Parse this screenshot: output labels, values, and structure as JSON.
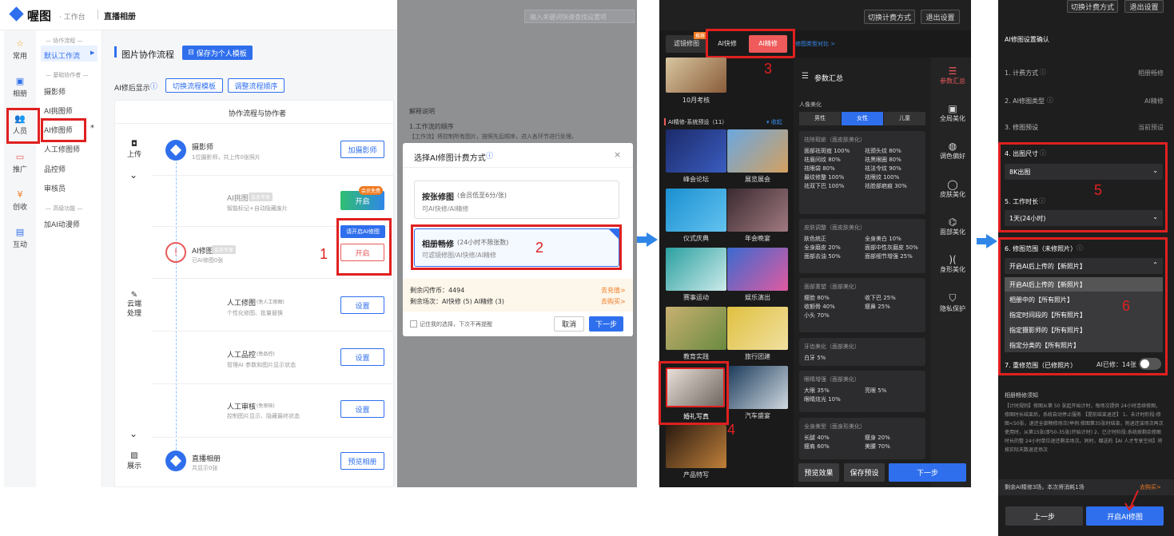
{
  "panel1": {
    "logo": "喔图",
    "workspace": "· 工作台",
    "breadcrumb": "直播相册",
    "nav": [
      {
        "label": "常用",
        "icon": "star-icon"
      },
      {
        "label": "相册",
        "icon": "album-icon"
      },
      {
        "label": "人员",
        "icon": "people-icon"
      },
      {
        "label": "推广",
        "icon": "promote-icon"
      },
      {
        "label": "创收",
        "icon": "revenue-icon"
      },
      {
        "label": "互动",
        "icon": "interact-icon"
      }
    ],
    "sub_groups": {
      "flow": "— 协作流程 —",
      "basic": "— 基础协作者 —",
      "advanced": "— 高级功能 —"
    },
    "sub_items": [
      "默认工作流",
      "摄影师",
      "AI挑图师",
      "AI修图师",
      "人工修图师",
      "品控师",
      "审核员",
      "加AI动漫师"
    ],
    "page_title": "图片协作流程",
    "save_template": "保存为个人模板",
    "ai_show_label": "AI修后显示",
    "switch_template": "切换流程模板",
    "adjust_order": "调整流程顺序",
    "table_header": "协作流程与协作者",
    "stages": [
      "上传",
      "云端处理",
      "展示"
    ],
    "rows": [
      {
        "title": "摄影师",
        "sub": "1位摄影师，共上传0张照片",
        "btn": "加摄影师"
      },
      {
        "title": "AI挑图",
        "tag": "会员专享",
        "sub": "智能标记+自动隐藏废片",
        "btn": "开启",
        "badge": "会员免费"
      },
      {
        "title": "AI修图",
        "tag": "会员专享",
        "sub": "已AI修图0张",
        "btn": "开启",
        "tip": "请开启AI修图"
      },
      {
        "title": "人工修图",
        "tag": "(免人工修图)",
        "sub": "个性化修图、批量替换",
        "btn": "设置"
      },
      {
        "title": "人工品控",
        "tag": "(免品控)",
        "sub": "管理AI 参数和图片显示状态",
        "btn": "设置"
      },
      {
        "title": "人工审核",
        "tag": "(免审核)",
        "sub": "控制图片显示、隐藏最终状态",
        "btn": "设置"
      },
      {
        "title": "直播相册",
        "sub": "共显示0张",
        "btn": "预览相册"
      }
    ]
  },
  "panel2": {
    "search_placeholder": "输入关键词快速查找设置项",
    "explain_title": "解释说明",
    "explain_line1": "1.工作流的顺序",
    "explain_line2": "【工作流】将控制所有图片，按照先后顺序，进入各环节进行处理。",
    "dialog_title": "选择AI修图计费方式",
    "opt1_title": "按张修图",
    "opt1_note": "(会员低至6分/张)",
    "opt1_sub": "可AI快修/AI精修",
    "opt2_title": "相册畅修",
    "opt2_note": "(24小时不限张数)",
    "opt2_sub": "可滤镜修图/AI快修/AI精修",
    "balance1": "剩余闪传币：4494",
    "balance1_link": "去充值>",
    "balance2": "剩余场次：AI快修 (5) AI精修 (3)",
    "balance2_link": "去购买>",
    "remember": "记住我的选择，下次不再提醒",
    "cancel": "取消",
    "next": "下一步"
  },
  "panel3": {
    "switch_billing": "切换计费方式",
    "exit": "退出设置",
    "tabs": [
      "滤镜修图",
      "AI快修",
      "AI精修"
    ],
    "tab_new": "推荐",
    "compare": "修图类型对比 >",
    "first_thumb": "10月考核",
    "preset_head": "AI精修-系统预设（11）",
    "collapse": "收起",
    "presets": [
      "峰会论坛",
      "展览展会",
      "仪式庆典",
      "年会晚宴",
      "赛事运动",
      "娱乐演出",
      "教育实践",
      "旅行团建",
      "婚礼写真",
      "汽车盛宴",
      "产品特写"
    ],
    "summary_title": "参数汇总",
    "portrait": "人像美化",
    "genders": [
      "男性",
      "女性",
      "儿童"
    ],
    "card1_title": "祛除瑕疵（面皮肤美化）",
    "card1": [
      "面部祛斑痘 100%",
      "祛颈头纹 80%",
      "祛眉间纹 80%",
      "祛黑眼圈 80%",
      "祛眼袋 80%",
      "祛法令纹 90%",
      "最纹修整 100%",
      "祛眼纹 100%",
      "祛双下巴 100%",
      "祛脸部疤痕 30%"
    ],
    "card2_title": "皮肤调整（面皮肤美化）",
    "card2": [
      "肤色统正",
      "全身美白 10%",
      "全身磨皮 20%",
      "面部中性灰磨皮 50%",
      "面部去油 50%",
      "面部细节增强 25%"
    ],
    "card3_title": "面部重塑（面部美化）",
    "card3": [
      "瘦脸 80%",
      "收下巴 25%",
      "收额骨 40%",
      "瘦鼻 25%",
      "小头 70%"
    ],
    "card4_title": "牙齿美化（面部美化）",
    "card4": [
      "白牙 5%"
    ],
    "card5_title": "眼睛增强（面部美化）",
    "card5": [
      "大眼 35%",
      "亮眼 5%",
      "眼睛炫光 10%"
    ],
    "card6_title": "全身美型（面身形美化）",
    "card6": [
      "长腿 40%",
      "瘦身 20%",
      "瘦肩 60%",
      "美腰 70%"
    ],
    "side": [
      "参数汇总",
      "全局美化",
      "调色偏好",
      "皮肤美化",
      "面部美化",
      "身形美化",
      "隐私保护"
    ],
    "preview": "预览效果",
    "save_preset": "保存预设",
    "next": "下一步"
  },
  "panel4": {
    "switch_billing": "切换计费方式",
    "exit": "退出设置",
    "title": "AI修图设置确认",
    "rows": [
      {
        "label": "1. 计费方式",
        "value": "相册畅修"
      },
      {
        "label": "2. AI修图类型",
        "value": "AI精修"
      },
      {
        "label": "3. 修图预设",
        "value": "当前预设"
      }
    ],
    "size_label": "4. 出图尺寸",
    "size_value": "8K出图",
    "duration_label": "5. 工作时长",
    "duration_value": "1天(24小时)",
    "range_label": "6. 修图范围（未修照片）",
    "range_value": "开启AI后上传的【新照片】",
    "range_options": [
      "开启AI后上传的【新照片】",
      "相册中的【所有照片】",
      "指定时间段的【所有照片】",
      "指定摄影师的【所有照片】",
      "指定分类的【所有照片】"
    ],
    "redo_label": "7. 重修范围（已修照片）",
    "redo_note": "AI已修：14张",
    "notice_title": "相册畅修须知",
    "notice": "【计时规则】修图从第 50 张起开始计时，每场次提供 24小时连续修图，修图时长结束后，系统自动停止服务 【提前结束退还】 1、未计时阶段:修图<50张，退还全部畅修场次(举例:修图第35张时结束，则退还该场次再次使用时，从第15张(即50-35张)开始计时) 2、已计时阶段:系统按剩余修图时长的整 24小时单位退还剩余场次。同时，赠送的【AI 人才专享空间】将按实际天数退还场次",
    "remain": "剩余AI精修3场，本次将消耗1场",
    "buy": "去购买>",
    "prev": "上一步",
    "start": "开启AI修图"
  },
  "markers": [
    "1",
    "2",
    "3",
    "4",
    "5",
    "6"
  ]
}
